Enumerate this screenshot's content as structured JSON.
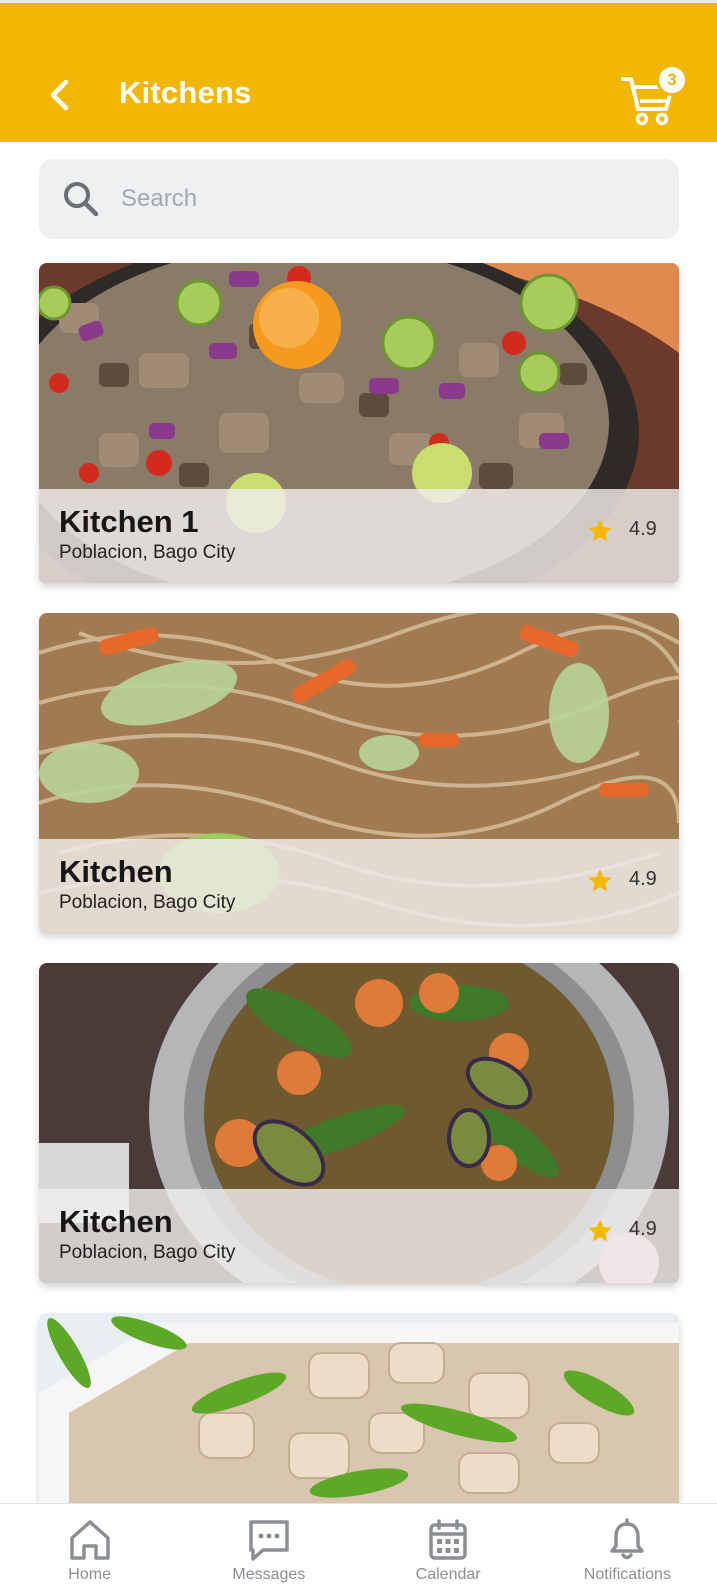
{
  "header": {
    "title": "Kitchens",
    "back_icon": "chevron-left-icon",
    "cart_icon": "cart-icon",
    "cart_count": "3",
    "background_color": "#f2b705"
  },
  "search": {
    "placeholder": "Search",
    "value": "",
    "icon": "search-icon"
  },
  "kitchens": [
    {
      "name": "Kitchen 1",
      "location": "Poblacion, Bago City",
      "rating": "4.9",
      "image": "sisig-dish-photo"
    },
    {
      "name": "Kitchen",
      "location": "Poblacion, Bago City",
      "rating": "4.9",
      "image": "pancit-noodles-photo"
    },
    {
      "name": "Kitchen",
      "location": "Poblacion, Bago City",
      "rating": "4.9",
      "image": "sinigang-soup-photo"
    },
    {
      "name": "",
      "location": "",
      "rating": "",
      "image": "pork-chili-dish-photo"
    }
  ],
  "nav": {
    "items": [
      {
        "label": "Home",
        "icon": "home-icon"
      },
      {
        "label": "Messages",
        "icon": "message-icon"
      },
      {
        "label": "Calendar",
        "icon": "calendar-icon"
      },
      {
        "label": "Notifications",
        "icon": "bell-icon"
      }
    ]
  },
  "colors": {
    "accent": "#f2b705",
    "star": "#f5b800",
    "nav_icon": "#8b8f94"
  }
}
